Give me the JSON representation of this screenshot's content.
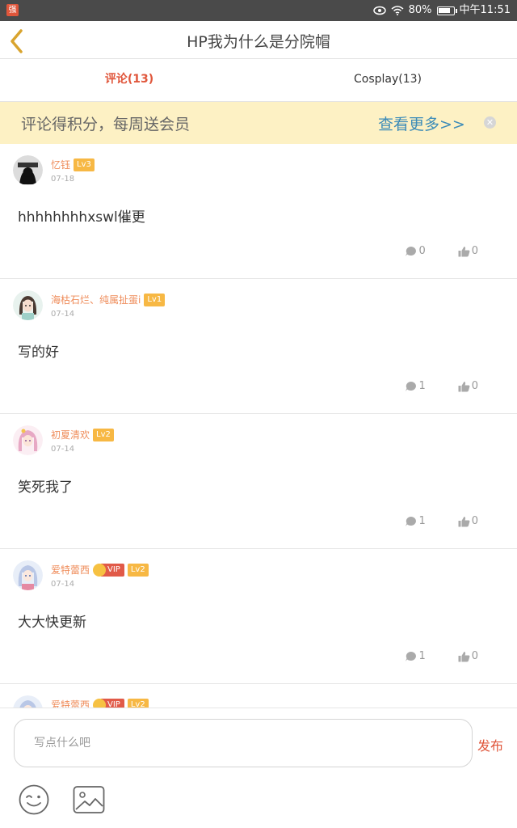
{
  "status_bar": {
    "app_icon_text": "强",
    "battery_text": "80%",
    "battery_level": 0.8,
    "time": "中午11:51"
  },
  "header": {
    "title": "HP我为什么是分院帽"
  },
  "tabs": [
    {
      "label": "评论(13)",
      "active": true
    },
    {
      "label": "Cosplay(13)",
      "active": false
    }
  ],
  "banner": {
    "text": "评论得积分，每周送会员",
    "link": "查看更多>>"
  },
  "comments": [
    {
      "username": "忆钰",
      "level": "Lv3",
      "vip": "",
      "date": "07-18",
      "content": "hhhhhhhhxswl催更",
      "replies": "0",
      "likes": "0"
    },
    {
      "username": "海枯石烂、纯属扯蛋i",
      "level": "Lv1",
      "vip": "",
      "date": "07-14",
      "content": "写的好",
      "replies": "1",
      "likes": "0"
    },
    {
      "username": "初夏清欢",
      "level": "Lv2",
      "vip": "",
      "date": "07-14",
      "content": "笑死我了",
      "replies": "1",
      "likes": "0"
    },
    {
      "username": "爱特蕾西",
      "level": "Lv2",
      "vip": "VIP",
      "date": "07-14",
      "content": "大大快更新",
      "replies": "1",
      "likes": "0"
    },
    {
      "username": "爱特蕾西",
      "level": "Lv2",
      "vip": "VIP",
      "date": "",
      "content": "",
      "replies": "",
      "likes": ""
    }
  ],
  "composer": {
    "placeholder": "写点什么吧",
    "publish_label": "发布"
  },
  "colors": {
    "accent": "#e0563b",
    "username": "#ef8c5a",
    "level_badge": "#f7b844",
    "banner_bg": "#fdf1c4",
    "banner_link": "#3d8cb8"
  }
}
